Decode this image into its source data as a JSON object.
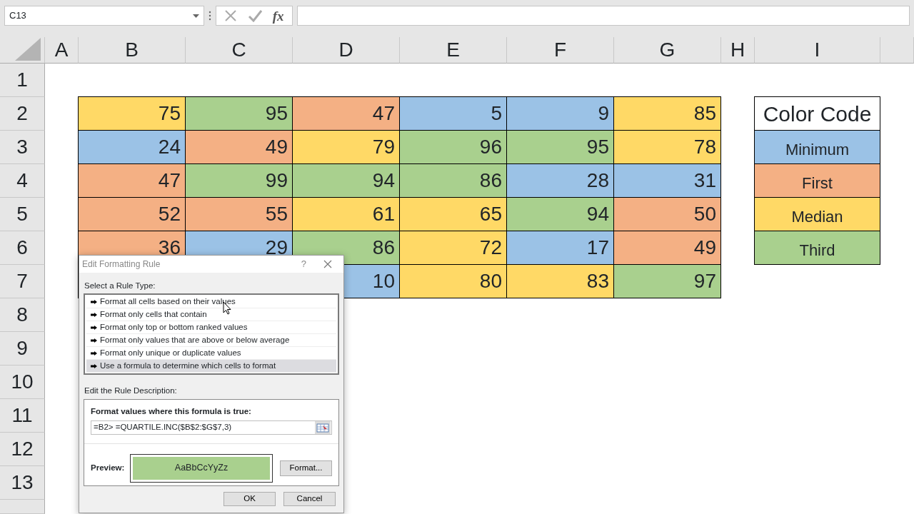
{
  "name_box": {
    "value": "C13"
  },
  "formula_bar": {
    "function_label": "fx"
  },
  "columns": [
    "A",
    "B",
    "C",
    "D",
    "E",
    "F",
    "G",
    "H",
    "I"
  ],
  "row_numbers": [
    "1",
    "2",
    "3",
    "4",
    "5",
    "6",
    "7",
    "8",
    "9",
    "10",
    "11",
    "12",
    "13"
  ],
  "data_rows": [
    [
      {
        "value": "75",
        "color": "#ffd966"
      },
      {
        "value": "95",
        "color": "#a9d08e"
      },
      {
        "value": "47",
        "color": "#f4b084"
      },
      {
        "value": "5",
        "color": "#9bc2e6"
      },
      {
        "value": "9",
        "color": "#9bc2e6"
      },
      {
        "value": "85",
        "color": "#ffd966"
      }
    ],
    [
      {
        "value": "24",
        "color": "#9bc2e6"
      },
      {
        "value": "49",
        "color": "#f4b084"
      },
      {
        "value": "79",
        "color": "#ffd966"
      },
      {
        "value": "96",
        "color": "#a9d08e"
      },
      {
        "value": "95",
        "color": "#a9d08e"
      },
      {
        "value": "78",
        "color": "#ffd966"
      }
    ],
    [
      {
        "value": "47",
        "color": "#f4b084"
      },
      {
        "value": "99",
        "color": "#a9d08e"
      },
      {
        "value": "94",
        "color": "#a9d08e"
      },
      {
        "value": "86",
        "color": "#a9d08e"
      },
      {
        "value": "28",
        "color": "#9bc2e6"
      },
      {
        "value": "31",
        "color": "#9bc2e6"
      }
    ],
    [
      {
        "value": "52",
        "color": "#f4b084"
      },
      {
        "value": "55",
        "color": "#f4b084"
      },
      {
        "value": "61",
        "color": "#ffd966"
      },
      {
        "value": "65",
        "color": "#ffd966"
      },
      {
        "value": "94",
        "color": "#a9d08e"
      },
      {
        "value": "50",
        "color": "#f4b084"
      }
    ],
    [
      {
        "value": "36",
        "color": "#f4b084"
      },
      {
        "value": "29",
        "color": "#9bc2e6"
      },
      {
        "value": "86",
        "color": "#a9d08e"
      },
      {
        "value": "72",
        "color": "#ffd966"
      },
      {
        "value": "17",
        "color": "#9bc2e6"
      },
      {
        "value": "49",
        "color": "#f4b084"
      }
    ],
    [
      null,
      null,
      {
        "value": "10",
        "color": "#9bc2e6"
      },
      {
        "value": "80",
        "color": "#ffd966"
      },
      {
        "value": "83",
        "color": "#ffd966"
      },
      {
        "value": "97",
        "color": "#a9d08e"
      }
    ]
  ],
  "legend": {
    "title": "Color Code",
    "items": [
      {
        "label": "Minimum",
        "color": "#9bc2e6"
      },
      {
        "label": "First",
        "color": "#f4b084"
      },
      {
        "label": "Median",
        "color": "#ffd966"
      },
      {
        "label": "Third",
        "color": "#a9d08e"
      }
    ]
  },
  "dialog": {
    "title": "Edit Formatting Rule",
    "help": "?",
    "rule_type_label": {
      "text": "Select a Rule Type:"
    },
    "rule_types": [
      {
        "label": "Format all cells based on their values",
        "selected": false
      },
      {
        "label": "Format only cells that contain",
        "selected": false
      },
      {
        "label": "Format only top or bottom ranked values",
        "selected": false
      },
      {
        "label": "Format only values that are above or below average",
        "selected": false
      },
      {
        "label": "Format only unique or duplicate values",
        "selected": false
      },
      {
        "label": "Use a formula to determine which cells to format",
        "selected": true
      }
    ],
    "description_label": {
      "text": "Edit the Rule Description:"
    },
    "formula_label": {
      "text": "Format values where this formula is true:"
    },
    "formula": "=B2> =QUARTILE.INC($B$2:$G$7,3)",
    "preview_label": "Preview:",
    "preview": {
      "sample": "AaBbCcYyZz",
      "color": "#a9d08e"
    },
    "format_button": {
      "text": "Format..."
    },
    "buttons": [
      "OK",
      "Cancel"
    ]
  }
}
